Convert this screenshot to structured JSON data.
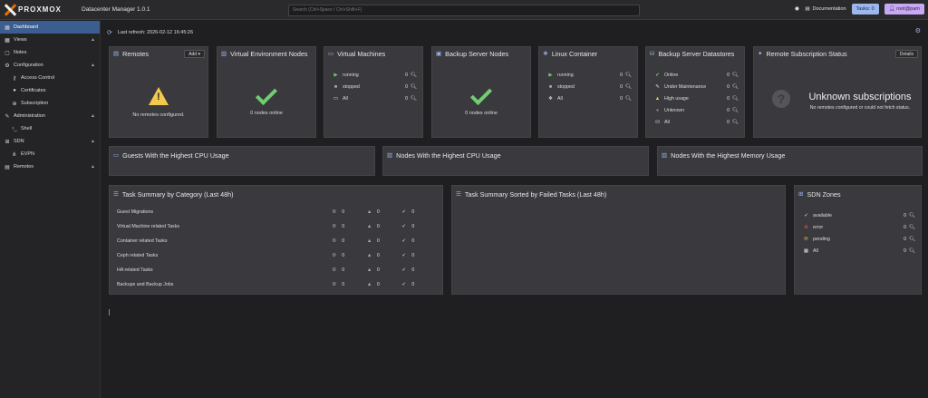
{
  "topbar": {
    "logo_text": "PROXMOX",
    "app_title": "Datacenter Manager 1.0.1",
    "search_placeholder": "Search (Ctrl+Space / Ctrl+Shift+F)",
    "documentation_label": "Documentation",
    "tasks_label": "Tasks: 0",
    "user_label": "root@pam"
  },
  "sidebar": {
    "items": [
      {
        "label": "Dashboard",
        "icon": "dashboard-icon"
      },
      {
        "label": "Views",
        "icon": "views-icon"
      },
      {
        "label": "Notes",
        "icon": "notes-icon"
      },
      {
        "label": "Configuration",
        "icon": "gears-icon"
      },
      {
        "label": "Access Control",
        "icon": "key-icon"
      },
      {
        "label": "Certificates",
        "icon": "certificate-icon"
      },
      {
        "label": "Subscription",
        "icon": "support-icon"
      },
      {
        "label": "Administration",
        "icon": "wrench-icon"
      },
      {
        "label": "Shell",
        "icon": "terminal-icon"
      },
      {
        "label": "SDN",
        "icon": "sdn-icon"
      },
      {
        "label": "EVPN",
        "icon": "network-icon"
      },
      {
        "label": "Remotes",
        "icon": "server-icon"
      }
    ]
  },
  "main": {
    "last_refresh": "Last refresh: 2026-02-12 16:45:26"
  },
  "panels": {
    "remotes": {
      "title": "Remotes",
      "add_label": "Add",
      "message": "No remotes configured."
    },
    "ve_nodes": {
      "title": "Virtual Environment Nodes",
      "message": "0 nodes online"
    },
    "vms": {
      "title": "Virtual Machines",
      "rows": [
        {
          "label": "running",
          "value": "0"
        },
        {
          "label": "stopped",
          "value": "0"
        },
        {
          "label": "All",
          "value": "0"
        }
      ]
    },
    "backup_nodes": {
      "title": "Backup Server Nodes",
      "message": "0 nodes online"
    },
    "containers": {
      "title": "Linux Container",
      "rows": [
        {
          "label": "running",
          "value": "0"
        },
        {
          "label": "stopped",
          "value": "0"
        },
        {
          "label": "All",
          "value": "0"
        }
      ]
    },
    "datastores": {
      "title": "Backup Server Datastores",
      "rows": [
        {
          "label": "Online",
          "value": "0"
        },
        {
          "label": "Under Maintenance",
          "value": "0"
        },
        {
          "label": "High usage",
          "value": "0"
        },
        {
          "label": "Unknown",
          "value": "0"
        },
        {
          "label": "All",
          "value": "0"
        }
      ]
    },
    "subscription": {
      "title": "Remote Subscription Status",
      "details_label": "Details",
      "status_title": "Unknown subscriptions",
      "status_message": "No remotes configured or could not fetch status."
    },
    "cpu_guests": {
      "title": "Guests With the Highest CPU Usage"
    },
    "cpu_nodes": {
      "title": "Nodes With the Highest CPU Usage"
    },
    "mem_nodes": {
      "title": "Nodes With the Highest Memory Usage"
    },
    "task_summary": {
      "title": "Task Summary by Category (Last 48h)",
      "rows": [
        {
          "label": "Guest Migrations",
          "a": "0",
          "b": "0",
          "c": "0"
        },
        {
          "label": "Virtual Machine related Tasks",
          "a": "0",
          "b": "0",
          "c": "0"
        },
        {
          "label": "Container related Tasks",
          "a": "0",
          "b": "0",
          "c": "0"
        },
        {
          "label": "Ceph related Tasks",
          "a": "0",
          "b": "0",
          "c": "0"
        },
        {
          "label": "HA related Tasks",
          "a": "0",
          "b": "0",
          "c": "0"
        },
        {
          "label": "Backups and Backup Jobs",
          "a": "0",
          "b": "0",
          "c": "0"
        }
      ]
    },
    "failed_tasks": {
      "title": "Task Summary Sorted by Failed Tasks (Last 48h)"
    },
    "sdn_zones": {
      "title": "SDN Zones",
      "rows": [
        {
          "label": "available",
          "value": "0"
        },
        {
          "label": "error",
          "value": "0"
        },
        {
          "label": "pending",
          "value": "0"
        },
        {
          "label": "All",
          "value": "0"
        }
      ]
    }
  },
  "colors": {
    "accent": "#9ab7ee",
    "active_nav": "#3b5d8f",
    "ok": "#6fcf6f",
    "warning": "#f2c94c",
    "error": "#e05a4f",
    "logo_orange": "#e57000"
  }
}
